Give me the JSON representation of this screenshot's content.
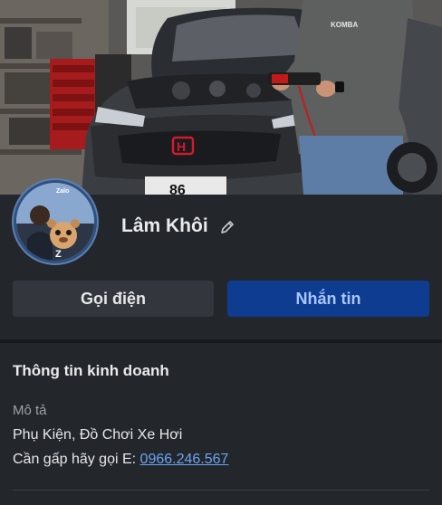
{
  "profile": {
    "name": "Lâm Khôi",
    "avatar_badge": "Zalo",
    "cover_plate_text": "86",
    "cover_shirt_text": "KOMBA"
  },
  "actions": {
    "call_label": "Gọi điện",
    "message_label": "Nhắn tin"
  },
  "business_info": {
    "title": "Thông tin kinh doanh",
    "description_label": "Mô tả",
    "line1": "Phụ Kiện, Đồ Chơi Xe Hơi",
    "line2_prefix": "Cần gấp hãy gọi E: ",
    "phone": "0966.246.567"
  },
  "colors": {
    "background": "#1e2126",
    "message_button": "#0e3c91",
    "message_text": "#a9c6ff",
    "link": "#6aa5f4"
  }
}
